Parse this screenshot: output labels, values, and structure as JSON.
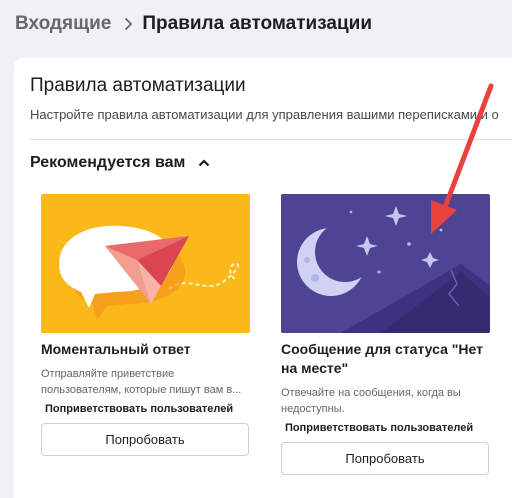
{
  "breadcrumb": {
    "parent": "Входящие",
    "current": "Правила автоматизации",
    "separator_icon": "chevron-right-icon"
  },
  "page": {
    "title": "Правила автоматизации",
    "subtitle": "Настройте правила автоматизации для управления вашими переписками и о"
  },
  "section": {
    "title": "Рекомендуется вам",
    "toggle_icon": "chevron-up-icon"
  },
  "cards": [
    {
      "title": "Моментальный ответ",
      "description": "Отправляйте приветствие пользователям, которые пишут вам в...",
      "badge": "Поприветствовать пользователей",
      "button": "Попробовать",
      "illustration": "paper-plane-speech-bubble",
      "accent": "#fbb81b"
    },
    {
      "title": "Сообщение для статуса \"Нет на месте\"",
      "description": "Отвечайте на сообщения, когда вы недоступны.",
      "badge": "Поприветствовать пользователей",
      "button": "Попробовать",
      "illustration": "moon-stars-mountains",
      "accent": "#4f4393"
    }
  ],
  "annotation": {
    "icon": "red-arrow-icon",
    "color": "#e8413e"
  }
}
